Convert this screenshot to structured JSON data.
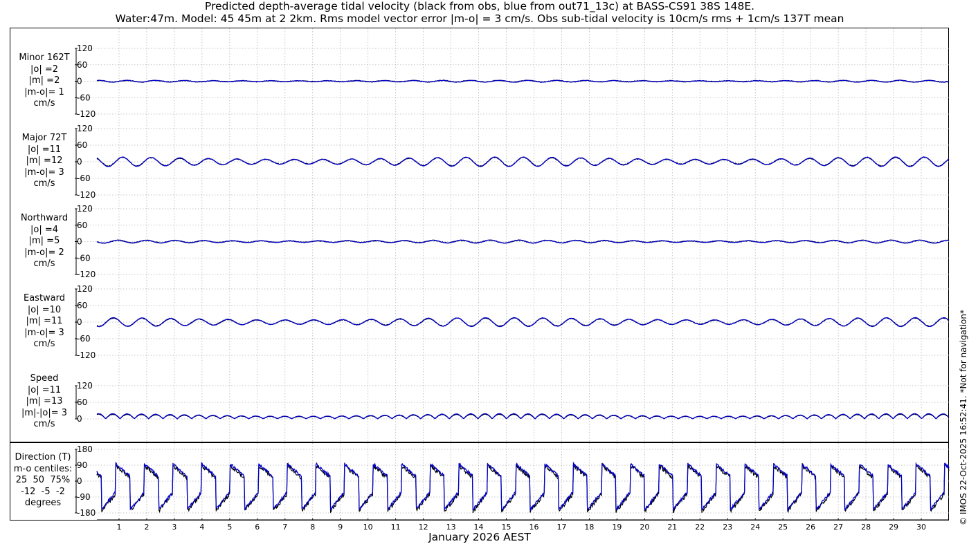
{
  "title": {
    "line1": "Predicted depth-average tidal velocity (black from obs, blue from out71_13c) at BASS-CS91 38S 148E.",
    "line2": "Water:47m. Model: 45 45m at 2 2km. Rms model vector error |m-o| = 3 cm/s. Obs sub-tidal velocity is 10cm/s rms + 1cm/s 137T mean"
  },
  "xaxis_label": "January 2026 AEST",
  "copyright": "© IMOS 22-Oct-2025 16:52:41. *Not for navigation*",
  "colors": {
    "obs": "#000000",
    "model": "#0000cc",
    "grid": "#b4b4b4",
    "frame": "#000000"
  },
  "panels": [
    {
      "id": "minor",
      "label_lines": [
        "Minor 162T",
        "|o| =2",
        "|m| =2",
        "|m-o|= 1",
        "cm/s"
      ]
    },
    {
      "id": "major",
      "label_lines": [
        "Major 72T",
        "|o| =11",
        "|m| =12",
        "|m-o|= 3",
        "cm/s"
      ]
    },
    {
      "id": "northward",
      "label_lines": [
        "Northward",
        "|o| =4",
        "|m| =5",
        "|m-o|= 2",
        "cm/s"
      ]
    },
    {
      "id": "eastward",
      "label_lines": [
        "Eastward",
        "|o| =10",
        "|m| =11",
        "|m-o|= 3",
        "cm/s"
      ]
    },
    {
      "id": "speed",
      "label_lines": [
        "Speed",
        "|o| =11",
        "|m| =13",
        "|m|-|o|= 3",
        "cm/s"
      ]
    },
    {
      "id": "direction",
      "label_lines": [
        "Direction (T)",
        "m-o centiles:",
        "25  50  75%",
        "-12  -5  -2",
        "degrees"
      ]
    }
  ],
  "chart_data": {
    "type": "line",
    "x_unit": "day of January 2026 (AEST)",
    "xlim": [
      0.2,
      31.0
    ],
    "x_ticks": [
      1,
      2,
      3,
      4,
      5,
      6,
      7,
      8,
      9,
      10,
      11,
      12,
      13,
      14,
      15,
      16,
      17,
      18,
      19,
      20,
      21,
      22,
      23,
      24,
      25,
      26,
      27,
      28,
      29,
      30
    ],
    "grid": true,
    "series_style": {
      "obs": "black",
      "model": "blue"
    },
    "panels": [
      {
        "id": "minor",
        "ylim": [
          -120,
          120
        ],
        "yticks": [
          120,
          60,
          0,
          -60,
          -120
        ],
        "amplitude": 3,
        "mean": 0
      },
      {
        "id": "major",
        "ylim": [
          -120,
          120
        ],
        "yticks": [
          120,
          60,
          0,
          -60,
          -120
        ],
        "amplitude": 16,
        "mean": 0
      },
      {
        "id": "northward",
        "ylim": [
          -120,
          120
        ],
        "yticks": [
          120,
          60,
          0,
          -60,
          -120
        ],
        "amplitude": 5,
        "mean": 0
      },
      {
        "id": "eastward",
        "ylim": [
          -120,
          120
        ],
        "yticks": [
          120,
          60,
          0,
          -60,
          -120
        ],
        "amplitude": 15,
        "mean": 0
      },
      {
        "id": "speed",
        "ylim": [
          0,
          120
        ],
        "yticks": [
          120,
          60,
          0
        ],
        "amplitude": 16,
        "mean": 0
      },
      {
        "id": "direction",
        "ylim": [
          -180,
          180
        ],
        "yticks": [
          180,
          90,
          0,
          -90,
          -180
        ]
      }
    ]
  }
}
